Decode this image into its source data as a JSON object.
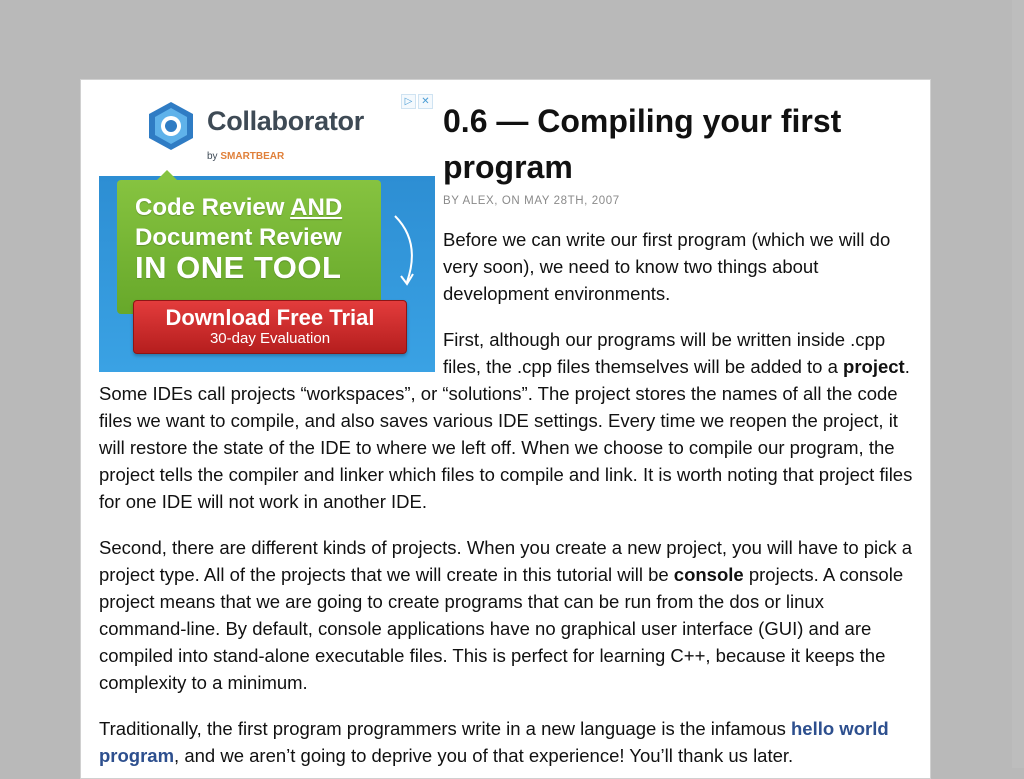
{
  "ad": {
    "brand": "Collaborator",
    "by_prefix": "by",
    "by_brand": "SMARTBEAR",
    "headline_1_pre": "Code Review ",
    "headline_1_emph": "AND",
    "headline_2": "Document Review",
    "headline_3": "IN ONE TOOL",
    "cta_main": "Download Free Trial",
    "cta_sub": "30-day Evaluation",
    "adchoices_icon": "▷",
    "close_icon": "✕"
  },
  "article": {
    "title": "0.6 — Compiling your first program",
    "meta": "BY ALEX, ON MAY 28TH, 2007",
    "p1": "Before we can write our first program (which we will do very soon), we need to know two things about development environments.",
    "p2_pre": "First, although our programs will be written inside .cpp files, the .cpp files themselves will be added to a ",
    "p2_bold": "project",
    "p2_post": ". Some IDEs call projects “workspaces”, or “solutions”. The project stores the names of all the code files we want to compile, and also saves various IDE settings. Every time we reopen the project, it will restore the state of the IDE to where we left off. When we choose to compile our program, the project tells the compiler and linker which files to compile and link. It is worth noting that project files for one IDE will not work in another IDE.",
    "p3_pre": "Second, there are different kinds of projects. When you create a new project, you will have to pick a project type. All of the projects that we will create in this tutorial will be ",
    "p3_bold": "console",
    "p3_post": " projects. A console project means that we are going to create programs that can be run from the dos or linux command-line. By default, console applications have no graphical user interface (GUI) and are compiled into stand-alone executable files. This is perfect for learning C++, because it keeps the complexity to a minimum.",
    "p4_pre": "Traditionally, the first program programmers write in a new language is the infamous ",
    "p4_link": "hello world program",
    "p4_post": ", and we aren’t going to deprive you of that experience! You’ll thank us later."
  },
  "colors": {
    "background": "#b9b9b9",
    "page": "#ffffff",
    "link": "#2d4f8e",
    "meta": "#8a8a8a",
    "ad_green": "#76b535",
    "ad_red": "#cc2b2b",
    "ad_blue": "#2d8ed3"
  }
}
